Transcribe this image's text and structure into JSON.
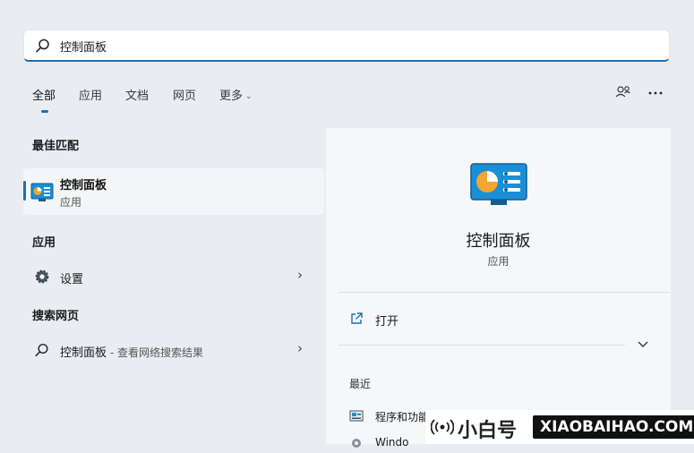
{
  "search": {
    "query": "控制面板"
  },
  "tabs": [
    {
      "label": "全部",
      "active": true
    },
    {
      "label": "应用"
    },
    {
      "label": "文档"
    },
    {
      "label": "网页"
    },
    {
      "label": "更多"
    }
  ],
  "top_actions": {
    "account_icon": "people-icon",
    "more_icon": "more-dots-icon"
  },
  "best_match": {
    "heading": "最佳匹配",
    "title": "控制面板",
    "subtitle": "应用"
  },
  "apps": {
    "heading": "应用",
    "items": [
      {
        "label": "设置"
      }
    ]
  },
  "web": {
    "heading": "搜索网页",
    "items": [
      {
        "label": "控制面板",
        "suffix": " - 查看网络搜索结果"
      }
    ]
  },
  "detail": {
    "title": "控制面板",
    "subtitle": "应用",
    "open_label": "打开",
    "recent_heading": "最近",
    "recent_items": [
      {
        "label": "程序和功能"
      },
      {
        "label": "Windo"
      }
    ]
  },
  "watermark": {
    "cn": "小白号",
    "en": "XIAOBAIHAO.COM"
  },
  "colors": {
    "accent": "#1f6fb2",
    "background": "#e9edf1",
    "panel": "#f5f7f9"
  }
}
